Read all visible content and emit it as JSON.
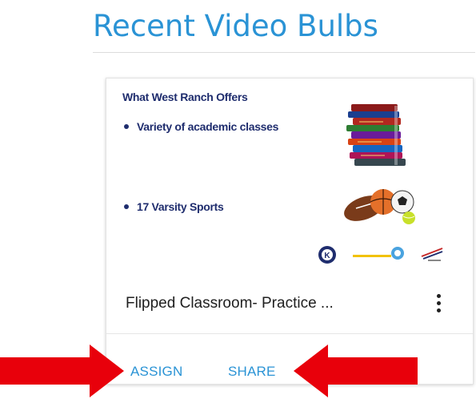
{
  "section": {
    "title": "Recent Video Bulbs"
  },
  "card": {
    "thumbnail": {
      "heading": "What West Ranch Offers",
      "bullets": [
        "Variety of academic classes",
        "17 Varsity Sports"
      ],
      "icons": [
        "stacked-books-icon",
        "sports-balls-icon",
        "kiwanis-logo",
        "club-logo",
        "fbla-logo"
      ]
    },
    "title": "Flipped Classroom- Practice ...",
    "actions": {
      "assign_label": "ASSIGN",
      "share_label": "SHARE"
    }
  },
  "annotations": {
    "arrow_color": "#e8000b"
  },
  "colors": {
    "accent": "#2a93d5",
    "slide_text": "#1f2d6e"
  }
}
